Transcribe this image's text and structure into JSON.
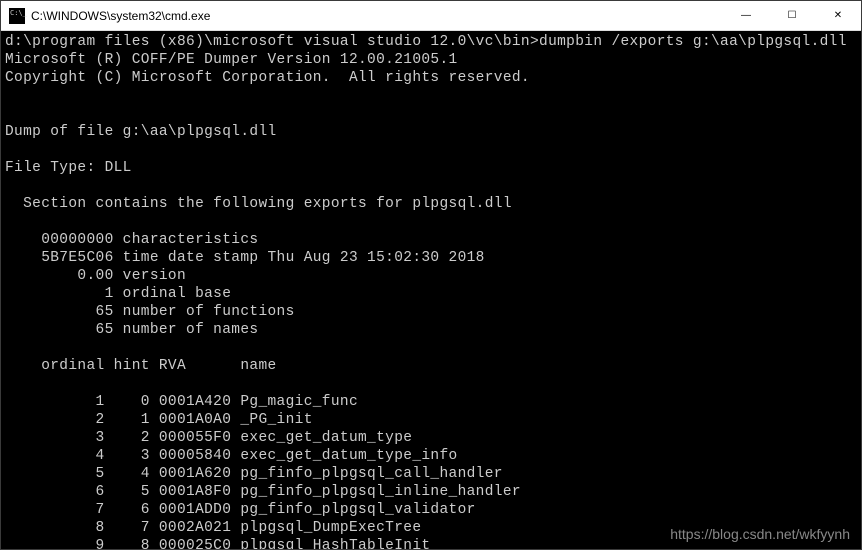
{
  "titlebar": {
    "title": "C:\\WINDOWS\\system32\\cmd.exe",
    "minimize": "—",
    "maximize": "☐",
    "close": "✕"
  },
  "terminal": {
    "command_line": "d:\\program files (x86)\\microsoft visual studio 12.0\\vc\\bin>dumpbin /exports g:\\aa\\plpgsql.dll",
    "version_line": "Microsoft (R) COFF/PE Dumper Version 12.00.21005.1",
    "copyright_line": "Copyright (C) Microsoft Corporation.  All rights reserved.",
    "dump_of": "Dump of file g:\\aa\\plpgsql.dll",
    "file_type": "File Type: DLL",
    "section_header": "  Section contains the following exports for plpgsql.dll",
    "meta": {
      "characteristics": "    00000000 characteristics",
      "timestamp": "    5B7E5C06 time date stamp Thu Aug 23 15:02:30 2018",
      "version": "        0.00 version",
      "ordinal_base": "           1 ordinal base",
      "num_functions": "          65 number of functions",
      "num_names": "          65 number of names"
    },
    "columns_header": "    ordinal hint RVA      name",
    "exports": [
      {
        "ordinal": "1",
        "hint": "0",
        "rva": "0001A420",
        "name": "Pg_magic_func"
      },
      {
        "ordinal": "2",
        "hint": "1",
        "rva": "0001A0A0",
        "name": "_PG_init"
      },
      {
        "ordinal": "3",
        "hint": "2",
        "rva": "000055F0",
        "name": "exec_get_datum_type"
      },
      {
        "ordinal": "4",
        "hint": "3",
        "rva": "00005840",
        "name": "exec_get_datum_type_info"
      },
      {
        "ordinal": "5",
        "hint": "4",
        "rva": "0001A620",
        "name": "pg_finfo_plpgsql_call_handler"
      },
      {
        "ordinal": "6",
        "hint": "5",
        "rva": "0001A8F0",
        "name": "pg_finfo_plpgsql_inline_handler"
      },
      {
        "ordinal": "7",
        "hint": "6",
        "rva": "0001ADD0",
        "name": "pg_finfo_plpgsql_validator"
      },
      {
        "ordinal": "8",
        "hint": "7",
        "rva": "0002A021",
        "name": "plpgsql_DumpExecTree"
      },
      {
        "ordinal": "9",
        "hint": "8",
        "rva": "000025C0",
        "name": "plpgsql_HashTableInit"
      }
    ]
  },
  "watermark": "https://blog.csdn.net/wkfyynh"
}
